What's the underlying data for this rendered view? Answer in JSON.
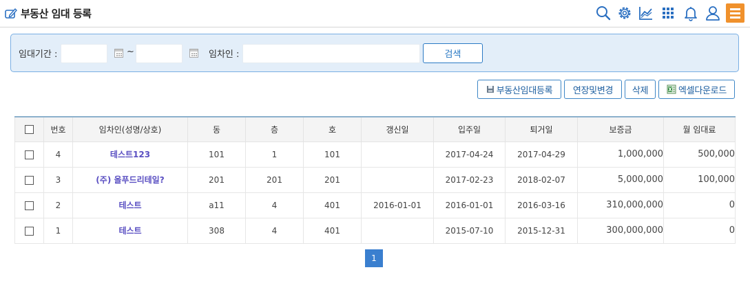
{
  "header": {
    "title": "부동산 임대 등록",
    "icons": [
      "search-icon",
      "gear-icon",
      "chart-icon",
      "grid-icon",
      "bell-icon",
      "user-icon",
      "menu-icon"
    ],
    "accent_color": "#f0912c",
    "icon_color": "#2a6fc1"
  },
  "search": {
    "period_label": "임대기간 :",
    "tilde": "~",
    "tenant_label": "임차인 :",
    "start_date": "",
    "end_date": "",
    "tenant_value": "",
    "search_button": "검색"
  },
  "actions": {
    "register": "부동산임대등록",
    "extend": "연장및변경",
    "delete": "삭제",
    "excel": "엑셀다운로드"
  },
  "table": {
    "columns": [
      "번호",
      "임차인(성명/상호)",
      "동",
      "층",
      "호",
      "갱신일",
      "입주일",
      "퇴거일",
      "보증금",
      "월 임대료"
    ],
    "rows": [
      {
        "no": "4",
        "tenant": "테스트123",
        "dong": "101",
        "floor": "1",
        "ho": "101",
        "renewal": "",
        "move_in": "2017-04-24",
        "move_out": "2017-04-29",
        "deposit": "1,000,000",
        "rent": "500,000"
      },
      {
        "no": "3",
        "tenant": "(주) 올푸드리테일?",
        "dong": "201",
        "floor": "201",
        "ho": "201",
        "renewal": "",
        "move_in": "2017-02-23",
        "move_out": "2018-02-07",
        "deposit": "5,000,000",
        "rent": "100,000"
      },
      {
        "no": "2",
        "tenant": "테스트",
        "dong": "a11",
        "floor": "4",
        "ho": "401",
        "renewal": "2016-01-01",
        "move_in": "2016-01-01",
        "move_out": "2016-03-16",
        "deposit": "310,000,000",
        "rent": "0"
      },
      {
        "no": "1",
        "tenant": "테스트",
        "dong": "308",
        "floor": "4",
        "ho": "401",
        "renewal": "",
        "move_in": "2015-07-10",
        "move_out": "2015-12-31",
        "deposit": "300,000,000",
        "rent": "0"
      }
    ]
  },
  "pagination": {
    "current": "1"
  }
}
